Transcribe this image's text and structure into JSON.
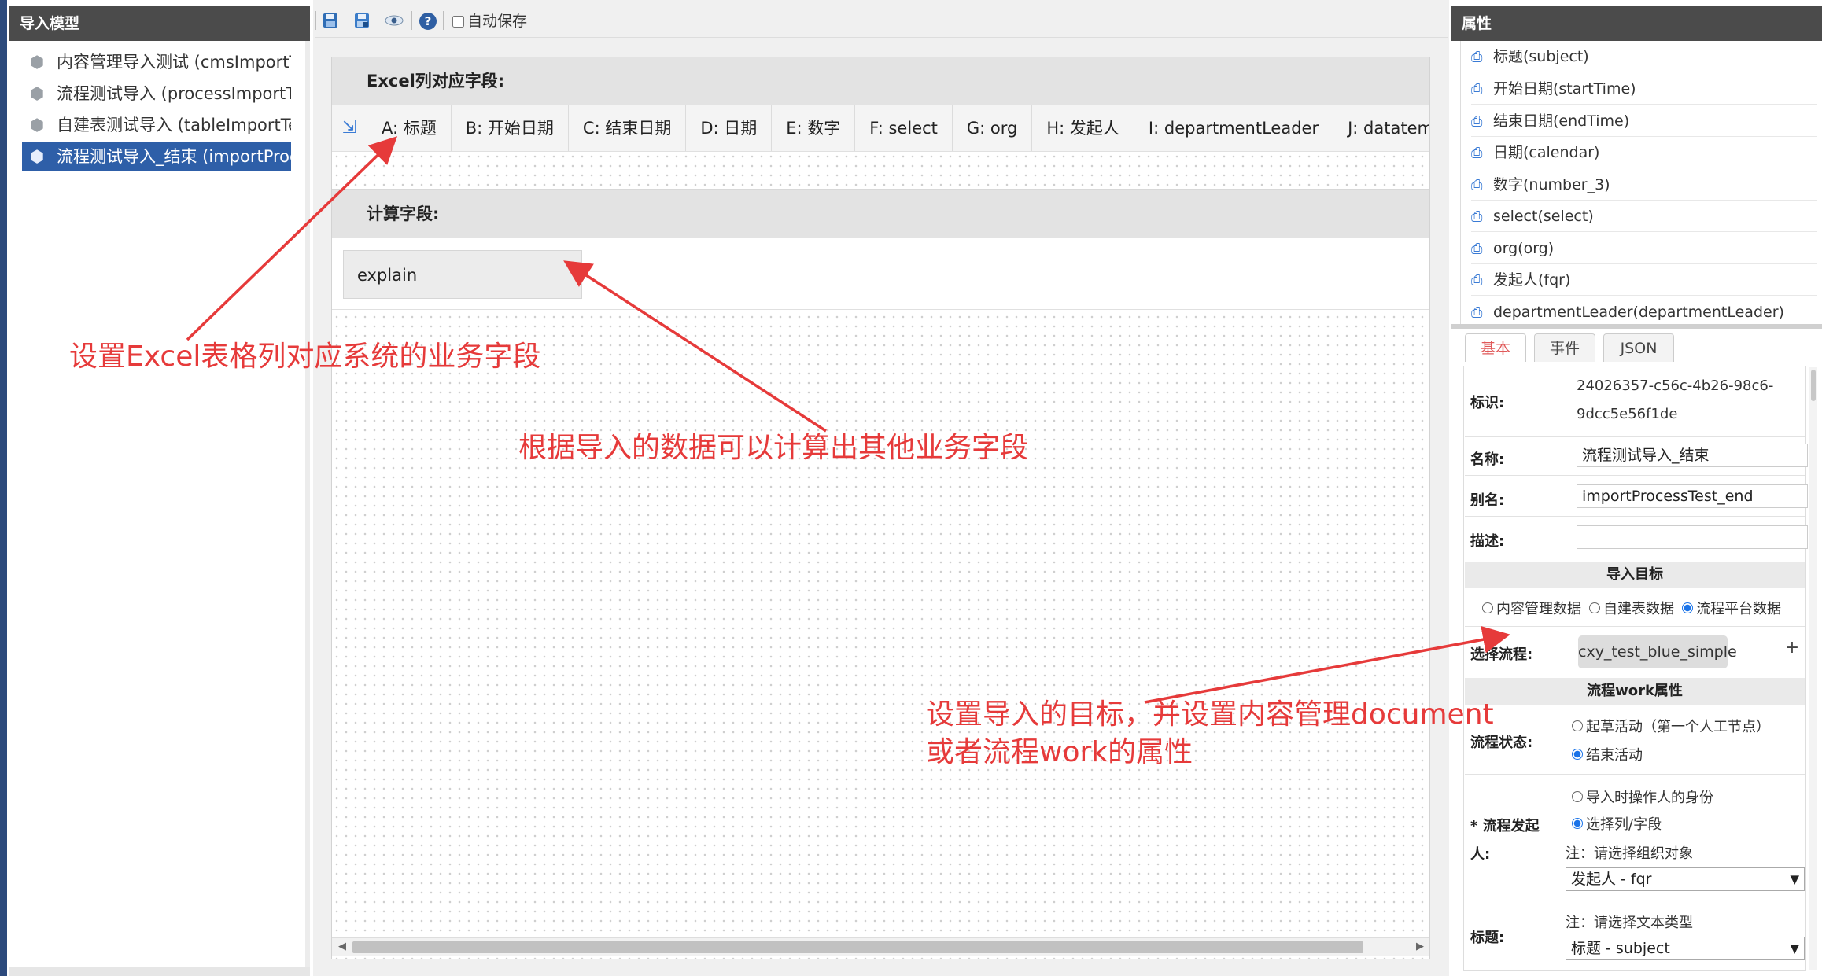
{
  "left_panel": {
    "title": "导入模型",
    "items": [
      {
        "label": "内容管理导入测试 (cmsImportT",
        "selected": false
      },
      {
        "label": "流程测试导入 (processImportT",
        "selected": false
      },
      {
        "label": "自建表测试导入 (tableImportTe",
        "selected": false
      },
      {
        "label": "流程测试导入_结束 (importProc",
        "selected": true
      }
    ]
  },
  "toolbar": {
    "icons": [
      "save-icon",
      "save-as-icon",
      "preview-icon",
      "help-icon"
    ],
    "autosave_label": "自动保存",
    "autosave_checked": false
  },
  "canvas": {
    "excel_section_title": "Excel列对应字段:",
    "columns": [
      "A: 标题",
      "B: 开始日期",
      "C: 结束日期",
      "D: 日期",
      "E: 数字",
      "F: select",
      "G: org",
      "H: 发起人",
      "I: departmentLeader",
      "J: datatemplate"
    ],
    "calc_section_title": "计算字段:",
    "calc_fields": [
      "explain"
    ]
  },
  "annotations": {
    "excel_mapping": "设置Excel表格列对应系统的业务字段",
    "calc_fields": "根据导入的数据可以计算出其他业务字段",
    "target_line1": "设置导入的目标，并设置内容管理document",
    "target_line2": "或者流程work的属性",
    "color": "#e63a3a"
  },
  "right_panel": {
    "title": "属性",
    "fields": [
      "标题(subject)",
      "开始日期(startTime)",
      "结束日期(endTime)",
      "日期(calendar)",
      "数字(number_3)",
      "select(select)",
      "org(org)",
      "发起人(fqr)",
      "departmentLeader(departmentLeader)"
    ],
    "tabs": [
      "基本",
      "事件",
      "JSON"
    ],
    "active_tab": "基本",
    "form": {
      "id_label": "标识:",
      "id_line1": "24026357-c56c-4b26-98c6-",
      "id_line2": "9dcc5e56f1de",
      "name_label": "名称:",
      "name_value": "流程测试导入_结束",
      "alias_label": "别名:",
      "alias_value": "importProcessTest_end",
      "desc_label": "描述:",
      "desc_value": "",
      "target_section": "导入目标",
      "target_options": [
        "内容管理数据",
        "自建表数据",
        "流程平台数据"
      ],
      "target_selected": "流程平台数据",
      "flow_label": "选择流程:",
      "flow_value": "cxy_test_blue_simple",
      "plus": "+",
      "work_section": "流程work属性",
      "status_label": "流程状态:",
      "status_options": [
        "起草活动（第一个人工节点）",
        "结束活动"
      ],
      "status_selected": "结束活动",
      "creator_label_1": "* 流程发起",
      "creator_label_2": "人:",
      "creator_options": [
        "导入时操作人的身份",
        "选择列/字段"
      ],
      "creator_selected": "选择列/字段",
      "creator_note": "注：请选择组织对象",
      "creator_select": "发起人 - fqr",
      "title_label": "标题:",
      "title_note": "注：请选择文本类型",
      "title_select": "标题 - subject"
    }
  }
}
